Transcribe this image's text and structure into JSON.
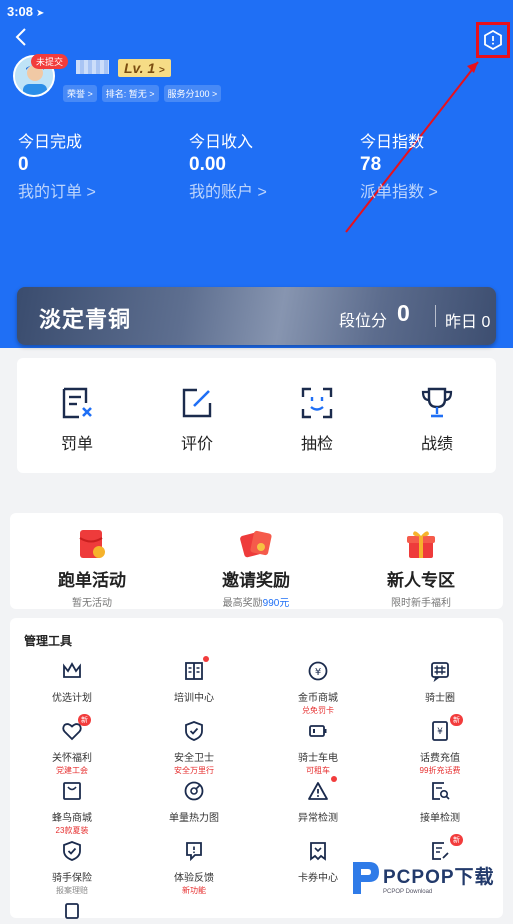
{
  "status_bar": {
    "time": "3:08",
    "location_icon": "navigation-arrow-icon"
  },
  "header": {
    "back_icon": "chevron-left-icon",
    "settings_icon": "hexagon-settings-icon",
    "highlight_color": "#e8101c"
  },
  "profile": {
    "avatar_badge": "未提交",
    "level": "Lv. 1",
    "tags": [
      "荣誉 >",
      "排名: 暂无 >",
      "服务分100 >"
    ]
  },
  "stats": [
    {
      "label": "今日完成",
      "value": "0",
      "link": "我的订单 >"
    },
    {
      "label": "今日收入",
      "value": "0.00",
      "link": "我的账户 >"
    },
    {
      "label": "今日指数",
      "value": "78",
      "link": "派单指数 >"
    }
  ],
  "rank": {
    "title": "淡定青铜",
    "segment_label": "段位分",
    "segment_value": "0",
    "yesterday": "昨日 0"
  },
  "quick_actions": [
    {
      "label": "罚单",
      "icon": "ticket-icon"
    },
    {
      "label": "评价",
      "icon": "edit-icon"
    },
    {
      "label": "抽检",
      "icon": "face-scan-icon"
    },
    {
      "label": "战绩",
      "icon": "trophy-icon"
    }
  ],
  "promos": [
    {
      "title": "跑单活动",
      "sub": "暂无活动",
      "icon": "red-envelope-icon"
    },
    {
      "title": "邀请奖励",
      "sub_prefix": "最高奖励",
      "sub_highlight": "990元",
      "icon": "envelopes-icon"
    },
    {
      "title": "新人专区",
      "sub": "限时新手福利",
      "icon": "gift-icon"
    }
  ],
  "tools": {
    "header": "管理工具",
    "items": [
      {
        "label": "优选计划",
        "icon": "crown-icon"
      },
      {
        "label": "培训中心",
        "icon": "book-icon"
      },
      {
        "label": "金币商城",
        "sub": "兑免罚卡",
        "icon": "coin-icon"
      },
      {
        "label": "骑士圈",
        "icon": "hash-icon"
      },
      {
        "label": "关怀福利",
        "sub": "党建工会",
        "icon": "heart-icon",
        "badge": "新"
      },
      {
        "label": "安全卫士",
        "sub": "安全万里行",
        "icon": "shield-check-icon"
      },
      {
        "label": "骑士车电",
        "sub": "可租车",
        "icon": "battery-icon"
      },
      {
        "label": "话费充值",
        "sub": "99折充话费",
        "icon": "phone-bill-icon",
        "badge": "新"
      },
      {
        "label": "蜂鸟商城",
        "sub": "23款夏装",
        "icon": "shop-bag-icon"
      },
      {
        "label": "单量热力图",
        "icon": "heatmap-icon"
      },
      {
        "label": "异常检测",
        "icon": "warning-icon"
      },
      {
        "label": "接单检测",
        "icon": "doc-search-icon"
      },
      {
        "label": "骑手保险",
        "sub": "报案理赔",
        "icon": "shield-icon"
      },
      {
        "label": "体验反馈",
        "sub": "新功能",
        "icon": "feedback-icon"
      },
      {
        "label": "卡券中心",
        "icon": "coupon-icon"
      },
      {
        "label": "",
        "icon": "doc-edit-icon",
        "badge": "新"
      }
    ]
  },
  "watermark": {
    "text": "PCPOP下载",
    "sub": "PCPOP Download"
  }
}
